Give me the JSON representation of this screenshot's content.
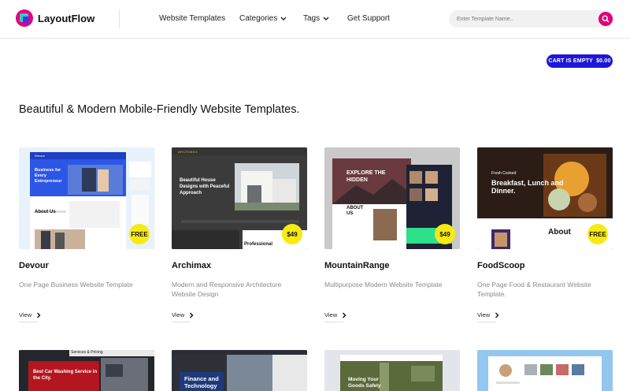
{
  "header": {
    "brand": "LayoutFlow",
    "nav": [
      {
        "label": "Website Templates"
      },
      {
        "label": "Categories"
      },
      {
        "label": "Tags"
      },
      {
        "label": "Get Support"
      }
    ],
    "search": {
      "placeholder": "Enter Template Name.."
    }
  },
  "cart": {
    "label": "CART IS EMPTY",
    "amount": "$0.00"
  },
  "page_title": "Beautiful & Modern Mobile-Friendly Website Templates.",
  "templates": [
    {
      "name": "Devour",
      "description": "One Page Business Website Template",
      "price": "FREE",
      "view_label": "View",
      "preview": {
        "headline": "Business for Every Entrepreneur",
        "section": "About Us",
        "top_label": "Devour"
      }
    },
    {
      "name": "Archimax",
      "description": "Modern and Responsive Architecture Website Design",
      "price": "$49",
      "view_label": "View",
      "preview": {
        "brand": "ARCHIMAX",
        "headline": "Beautiful House Designs with Peaceful Approach",
        "section": "Professional"
      }
    },
    {
      "name": "MountainRange",
      "description": "Multipurpose Modern Website Template",
      "price": "$49",
      "view_label": "View",
      "preview": {
        "headline": "EXPLORE THE HIDDEN",
        "section": "ABOUT US"
      }
    },
    {
      "name": "FoodScoop",
      "description": "One Page Food & Restaurant Website Template.",
      "price": "FREE",
      "view_label": "View",
      "preview": {
        "kicker": "Fresh Cooked",
        "headline": "Breakfast, Lunch and Dinner.",
        "section": "About"
      }
    }
  ],
  "second_row": [
    {
      "preview_text": "Best Car Washing Service in the City.",
      "top_text": "Services & Pricing"
    },
    {
      "preview_text": "Finance and Technology"
    },
    {
      "preview_text": "Moving Your Goods Safely"
    },
    {
      "preview_text": ""
    }
  ],
  "colors": {
    "accent": "#e0007a",
    "cart": "#1e17d8",
    "badge": "#f7ea12"
  }
}
